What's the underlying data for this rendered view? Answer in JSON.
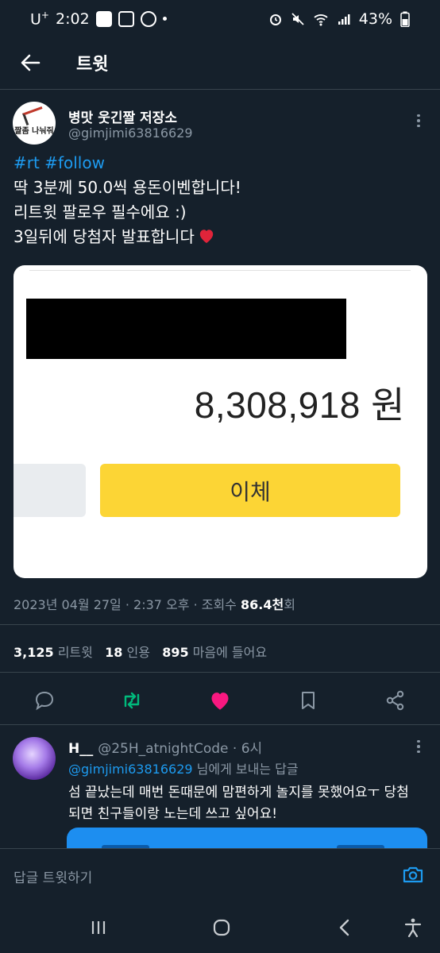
{
  "status_bar": {
    "carrier": "U",
    "carrier_sup": "+",
    "time": "2:02",
    "battery": "43%"
  },
  "header": {
    "title": "트윗"
  },
  "tweet": {
    "author_name": "병맛 웃긴짤 저장소",
    "author_handle": "@gimjimi63816629",
    "avatar_text": "짤좀 나눠줘",
    "hashtags": "#rt #follow",
    "line2": "딱 3분께 50.0씩 용돈이벤합니다!",
    "line3": "리트윗 팔로우 필수에요 :)",
    "line4": "3일뒤에 당첨자 발표합니다",
    "media": {
      "amount": "8,308,918 원",
      "transfer_label": "이체"
    },
    "meta_prefix": "2023년 04월 27일 · 2:37 오후 · 조회수 ",
    "views": "86.4천",
    "views_suffix": "회",
    "retweets": "3,125",
    "retweets_label": " 리트윗",
    "quotes": "18",
    "quotes_label": " 인용",
    "likes": "895",
    "likes_label": " 마음에 들어요"
  },
  "reply": {
    "name": "H__",
    "handle_time": "@25H_atnightCode · 6시",
    "reply_to_handle": "@gimjimi63816629",
    "reply_to_suffix": " 님에게 보내는 답글",
    "line1": "섬 끝났는데 매번 돈때문에 맘편하게 놀지를 못했어요ㅜ 당첨",
    "line2": "되면 친구들이랑 노는데 쓰고 싶어요!"
  },
  "compose": {
    "placeholder": "답글 트윗하기"
  },
  "colors": {
    "background": "#15202b",
    "accent": "#1d9bf0",
    "retweet_active": "#00ba7c",
    "like_active": "#f91880",
    "transfer_button": "#fcd535"
  },
  "icons": [
    "back-arrow-icon",
    "more-icon",
    "reply-icon",
    "retweet-icon",
    "heart-icon",
    "bookmark-icon",
    "share-icon",
    "camera-icon",
    "recents-icon",
    "home-icon",
    "back-nav-icon",
    "accessibility-icon"
  ]
}
